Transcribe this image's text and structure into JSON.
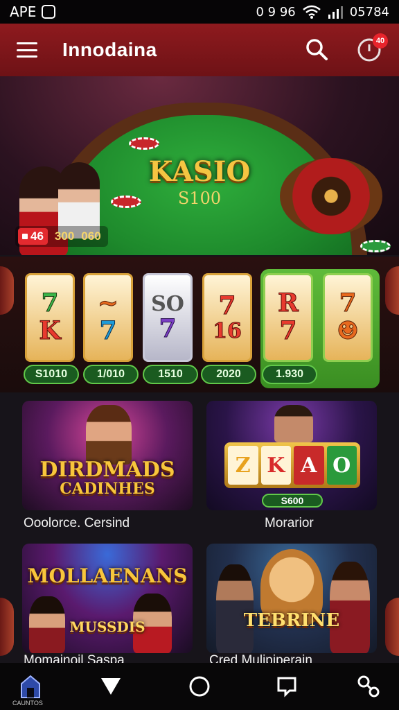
{
  "status_bar": {
    "carrier": "APE",
    "icons_text": "0 9 96",
    "time": "05784"
  },
  "app_bar": {
    "title": "Innodaina",
    "notification_count": "40"
  },
  "hero": {
    "title": "KASIO",
    "subtitle": "S100",
    "live_label": "46",
    "stat_1": "300",
    "stat_2": "060"
  },
  "slots": {
    "cards": [
      {
        "top": "7",
        "bottom": "K"
      },
      {
        "top": "~",
        "bottom": "7"
      },
      {
        "top": "SO",
        "bottom": "7"
      },
      {
        "top": "7",
        "bottom": "16"
      },
      {
        "top": "R",
        "bottom": "7"
      },
      {
        "top": "7",
        "bottom": "☻"
      }
    ],
    "prizes": [
      "S1010",
      "1/010",
      "1510",
      "2020",
      "1.930"
    ]
  },
  "games": [
    {
      "logo_line1": "DIRDMADS",
      "logo_line2": "CADINHES",
      "caption": "Ooolorce. Cersind"
    },
    {
      "reel_symbols": [
        "Z",
        "K",
        "A",
        "O"
      ],
      "prize": "S600",
      "caption": "Morarior"
    },
    {
      "logo_line1": "MOLLAENANS",
      "logo_line2": "MUSSDIS",
      "caption": "Momainoil Saspa"
    },
    {
      "logo_line1": "TEBRINE",
      "caption": "Cred Mulipiperain"
    }
  ],
  "bottom_nav": {
    "home_label": "CAUNTOS",
    "items": [
      "home-icon",
      "triangle-back-icon",
      "circle-home-icon",
      "square-recents-icon",
      "share-icon"
    ]
  },
  "colors": {
    "app_bar": "#8e1a1e",
    "felt": "#1e8a2c",
    "gold": "#f5c542",
    "prize_green": "#1a5b20"
  }
}
